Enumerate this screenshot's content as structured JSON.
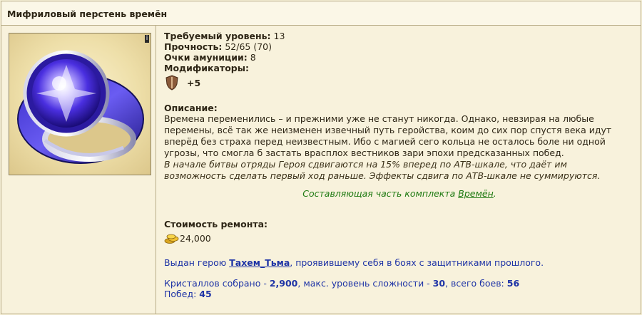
{
  "title": "Мифриловый перстень времён",
  "item": {
    "image_icon": "sapphire-ring-icon",
    "info_button": "i"
  },
  "stats": {
    "level_label": "Требуемый уровень:",
    "level_value": "13",
    "durability_label": "Прочность:",
    "durability_value": "52/65  (70)",
    "ammo_label": "Очки амуниции:",
    "ammo_value": "8",
    "modifiers_label": "Модификаторы:",
    "modifier_icon": "shield-icon",
    "modifier_value": "+5"
  },
  "description": {
    "label": "Описание:",
    "text": "Времена переменились – и прежними уже не станут никогда. Однако, невзирая на любые перемены, всё так же неизменен извечный путь геройства, коим до сих пор спустя века идут вперёд без страха перед неизвестным. Ибо с магией сего кольца не осталось боле ни одной угрозы, что смогла б застать врасплох вестников зари эпохи предсказанных побед.",
    "effect": "В начале битвы отряды Героя сдвигаются на 15% вперед по АТВ-шкале, что даёт им возможность сделать первый ход раньше. Эффекты сдвига по АТВ-шкале не суммируются."
  },
  "set": {
    "prefix": "Составляющая часть комплекта ",
    "link": "Времён",
    "suffix": "."
  },
  "repair": {
    "label": "Стоимость ремонта:",
    "icon": "gold-icon",
    "value": "24,000"
  },
  "issued": {
    "prefix": "Выдан герою ",
    "hero": "Тахем_Тьма",
    "suffix": ", проявившему себя в боях с защитниками прошлого."
  },
  "stats_footer": {
    "crystals_label": "Кристаллов собрано - ",
    "crystals_value": "2,900",
    "level_label": ", макс. уровень сложности - ",
    "level_value": "30",
    "battles_label": ", всего боев: ",
    "battles_value": "56",
    "wins_label": "Побед: ",
    "wins_value": "45"
  }
}
